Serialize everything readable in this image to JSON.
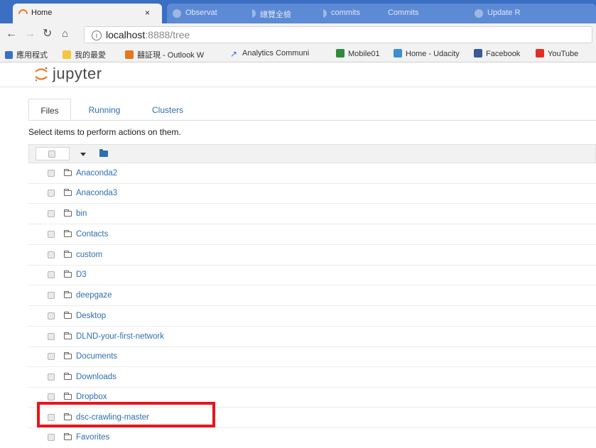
{
  "browser": {
    "tabs": [
      {
        "title": "Home",
        "close": "×"
      },
      {
        "title": "Observat"
      },
      {
        "title": "總覽全檢"
      },
      {
        "title": "commits"
      },
      {
        "title": "Commits"
      },
      {
        "title": "Update R"
      }
    ],
    "address": {
      "info_icon": "i",
      "host": "localhost",
      "path": ":8888/tree"
    },
    "bookmarks": [
      {
        "label": "應用程式",
        "icon": "apps-grid-icon",
        "color": "#3a6fc4"
      },
      {
        "label": "我的最愛",
        "icon": "folder-icon",
        "color": "#f5c542"
      },
      {
        "label": "囍証現 - Outlook W",
        "icon": "outlook-icon",
        "color": "#e8761c"
      },
      {
        "label": "Analytics Communi",
        "icon": "analytics-icon",
        "color": "#3a6fc4"
      },
      {
        "label": "Mobile01",
        "icon": "mobile01-icon",
        "color": "#2e8b3a"
      },
      {
        "label": "Home - Udacity",
        "icon": "udacity-icon",
        "color": "#3a8fd4"
      },
      {
        "label": "Facebook",
        "icon": "facebook-icon",
        "color": "#3b5998"
      },
      {
        "label": "YouTube",
        "icon": "youtube-icon",
        "color": "#e52d27"
      }
    ]
  },
  "jupyter": {
    "logo_text": "jupyter",
    "tabs": [
      "Files",
      "Running",
      "Clusters"
    ],
    "instruction": "Select items to perform actions on them.",
    "files": [
      "Anaconda2",
      "Anaconda3",
      "bin",
      "Contacts",
      "custom",
      "D3",
      "deepgaze",
      "Desktop",
      "DLND-your-first-network",
      "Documents",
      "Downloads",
      "Dropbox",
      "dsc-crawling-master",
      "Favorites"
    ],
    "highlighted_file": "dsc-crawling-master",
    "link_color": "#2e6fb0",
    "highlight_color": "#e8141b"
  }
}
